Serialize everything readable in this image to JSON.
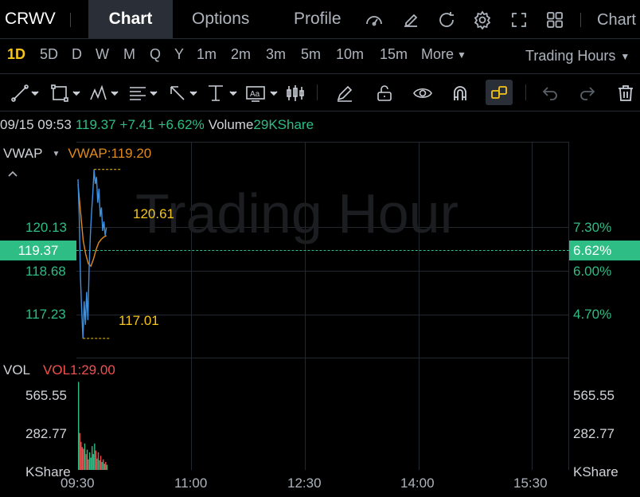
{
  "header": {
    "symbol": "CRWV",
    "tabs": [
      {
        "label": "Chart",
        "active": true
      },
      {
        "label": "Options",
        "active": false
      },
      {
        "label": "Profile",
        "active": false
      }
    ],
    "right_label": "Chart",
    "icons": [
      "gauge-icon",
      "edit-icon",
      "refresh-icon",
      "settings-icon",
      "fullscreen-icon",
      "grid-layout-icon"
    ]
  },
  "periods": {
    "items": [
      "1D",
      "5D",
      "D",
      "W",
      "M",
      "Q",
      "Y",
      "1m",
      "2m",
      "3m",
      "5m",
      "10m",
      "15m"
    ],
    "active": "1D",
    "more_label": "More",
    "trading_hours_label": "Trading Hours"
  },
  "toolbar": {
    "tools": [
      "line-tool-icon",
      "rectangle-tool-icon",
      "pattern-tool-icon",
      "fibonacci-tool-icon",
      "arrow-tool-icon",
      "vertical-line-tool-icon",
      "text-tool-icon",
      "candle-tool-icon",
      "pencil-icon",
      "unlock-icon",
      "eye-icon",
      "magnet-icon",
      "link-icon",
      "undo-icon",
      "redo-icon",
      "trash-icon"
    ]
  },
  "quote": {
    "datetime": "09/15 09:53",
    "price": "119.37",
    "change": "+7.41",
    "change_pct": "+6.62%",
    "volume_label": "Volume",
    "volume_value": "29KShare"
  },
  "price_panel": {
    "indicator_name": "VWAP",
    "indicator_value": "VWAP:119.20",
    "watermark": "Trading Hour",
    "current_price": "119.37",
    "current_pct": "6.62%",
    "left_ticks": [
      "120.13",
      "118.68",
      "117.23"
    ],
    "right_ticks": [
      "7.30%",
      "6.00%",
      "4.70%"
    ],
    "high_label": "120.61",
    "low_label": "117.01"
  },
  "volume_panel": {
    "indicator_name": "VOL",
    "indicator_value": "VOL1:29.00",
    "left_ticks": [
      "565.55",
      "282.77",
      "KShare"
    ],
    "right_ticks": [
      "565.55",
      "282.77",
      "KShare"
    ]
  },
  "time_axis": [
    "09:30",
    "11:00",
    "12:30",
    "14:00",
    "15:30"
  ],
  "colors": {
    "accent": "#f5c518",
    "up": "#2ebd85",
    "down": "#f0504f",
    "vwap": "#e08a1e",
    "price_line": "#3d8fe0"
  },
  "chart_data": {
    "type": "line",
    "price_series": {
      "x": [
        "09:30",
        "09:31",
        "09:32",
        "09:33",
        "09:34",
        "09:35",
        "09:36",
        "09:37",
        "09:38",
        "09:39",
        "09:40",
        "09:41",
        "09:42",
        "09:43",
        "09:44",
        "09:45",
        "09:46",
        "09:47",
        "09:48",
        "09:49",
        "09:50",
        "09:51",
        "09:52",
        "09:53"
      ],
      "values": [
        120.4,
        119.6,
        118.3,
        117.6,
        117.01,
        117.8,
        117.3,
        118.0,
        117.4,
        118.5,
        119.2,
        119.7,
        120.1,
        120.61,
        120.3,
        120.45,
        119.9,
        120.2,
        119.6,
        119.8,
        119.3,
        119.5,
        119.2,
        119.37
      ]
    },
    "vwap_series": {
      "x": [
        "09:30",
        "09:32",
        "09:34",
        "09:36",
        "09:38",
        "09:40",
        "09:42",
        "09:44",
        "09:46",
        "09:48",
        "09:50",
        "09:53"
      ],
      "values": [
        120.3,
        119.7,
        119.1,
        118.8,
        118.6,
        118.55,
        118.7,
        118.9,
        119.05,
        119.12,
        119.17,
        119.2
      ]
    },
    "volume_series": {
      "values": [
        500,
        210,
        160,
        130,
        120,
        150,
        90,
        115,
        60,
        100,
        70,
        135,
        90,
        150,
        110,
        65,
        100,
        55,
        80,
        45,
        60,
        35,
        45,
        29
      ]
    },
    "ylim": [
      116.6,
      121.2
    ],
    "vol_ylim": [
      0,
      565.55
    ],
    "high": 120.61,
    "low": 117.01
  }
}
